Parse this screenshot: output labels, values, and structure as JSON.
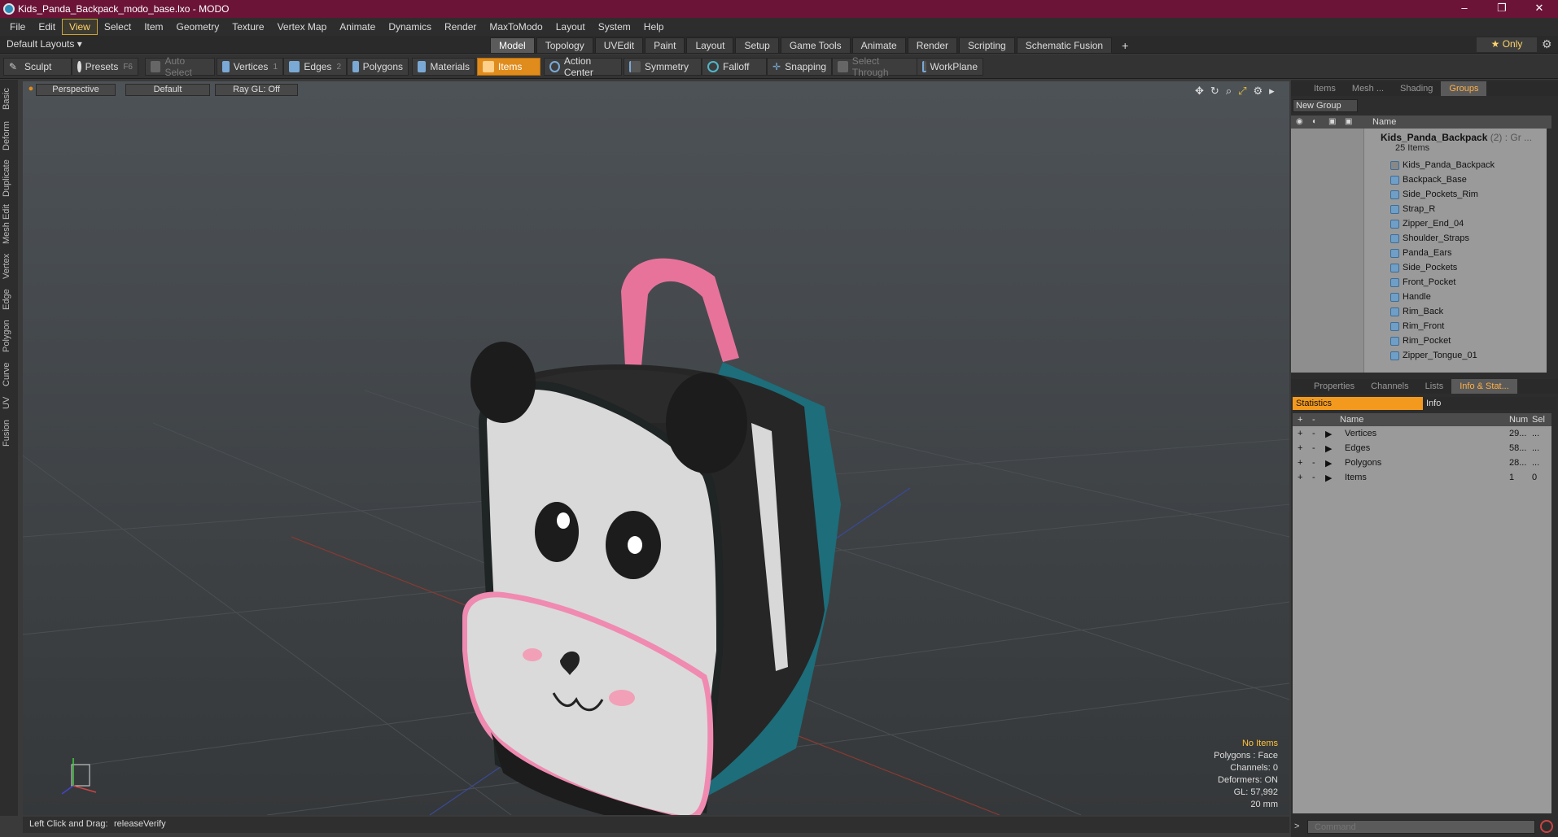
{
  "window": {
    "title": "Kids_Panda_Backpack_modo_base.lxo - MODO",
    "minimize": "–",
    "maximize": "❐",
    "close": "✕"
  },
  "menu": [
    "File",
    "Edit",
    "View",
    "Select",
    "Item",
    "Geometry",
    "Texture",
    "Vertex Map",
    "Animate",
    "Dynamics",
    "Render",
    "MaxToModo",
    "Layout",
    "System",
    "Help"
  ],
  "menu_active": "View",
  "layout": {
    "default_layouts": "Default Layouts ▾",
    "tabs": [
      "Model",
      "Topology",
      "UVEdit",
      "Paint",
      "Layout",
      "Setup",
      "Game Tools",
      "Animate",
      "Render",
      "Scripting",
      "Schematic Fusion"
    ],
    "active_tab": "Model",
    "plus": "+",
    "only": "★ Only"
  },
  "toolbar": {
    "sculpt": "Sculpt",
    "presets": "Presets",
    "presets_key": "F6",
    "auto_select": "Auto Select",
    "vertices": "Vertices",
    "vertices_num": "1",
    "edges": "Edges",
    "edges_num": "2",
    "polygons": "Polygons",
    "materials": "Materials",
    "items": "Items",
    "action_center": "Action Center",
    "symmetry": "Symmetry",
    "falloff": "Falloff",
    "snapping": "Snapping",
    "select_through": "Select Through",
    "workplane": "WorkPlane"
  },
  "left_tabs": [
    "Basic",
    "Deform",
    "Duplicate",
    "Mesh Edit",
    "Vertex",
    "Edge",
    "Polygon",
    "Curve",
    "UV",
    "Fusion"
  ],
  "viewport": {
    "perspective": "Perspective",
    "default": "Default",
    "raygl": "Ray GL: Off",
    "stats": [
      "No Items",
      "Polygons : Face",
      "Channels: 0",
      "Deformers: ON",
      "GL: 57,992",
      "20 mm"
    ]
  },
  "status": {
    "hint": "Left Click and Drag:",
    "value": "releaseVerify"
  },
  "items_panel": {
    "tabs": [
      "Items",
      "Mesh ...",
      "Shading",
      "Groups"
    ],
    "active_tab": "Groups",
    "new_group": "New Group",
    "col_name": "Name",
    "root": "Kids_Panda_Backpack",
    "root_suffix": "(2) : Gr ...",
    "root_count": "25 Items",
    "children": [
      "Kids_Panda_Backpack",
      "Backpack_Base",
      "Side_Pockets_Rim",
      "Strap_R",
      "Zipper_End_04",
      "Shoulder_Straps",
      "Panda_Ears",
      "Side_Pockets",
      "Front_Pocket",
      "Handle",
      "Rim_Back",
      "Rim_Front",
      "Rim_Pocket",
      "Zipper_Tongue_01"
    ]
  },
  "stats_panel": {
    "tabs": [
      "Properties",
      "Channels",
      "Lists",
      "Info & Stat..."
    ],
    "active_tab": "Info & Stat...",
    "statistics": "Statistics",
    "info": "Info",
    "col_name": "Name",
    "col_num": "Num",
    "col_sel": "Sel",
    "rows": [
      {
        "name": "Vertices",
        "num": "29...",
        "sel": "..."
      },
      {
        "name": "Edges",
        "num": "58...",
        "sel": "..."
      },
      {
        "name": "Polygons",
        "num": "28...",
        "sel": "..."
      },
      {
        "name": "Items",
        "num": "1",
        "sel": "0"
      }
    ]
  },
  "command": {
    "placeholder": "Command"
  }
}
